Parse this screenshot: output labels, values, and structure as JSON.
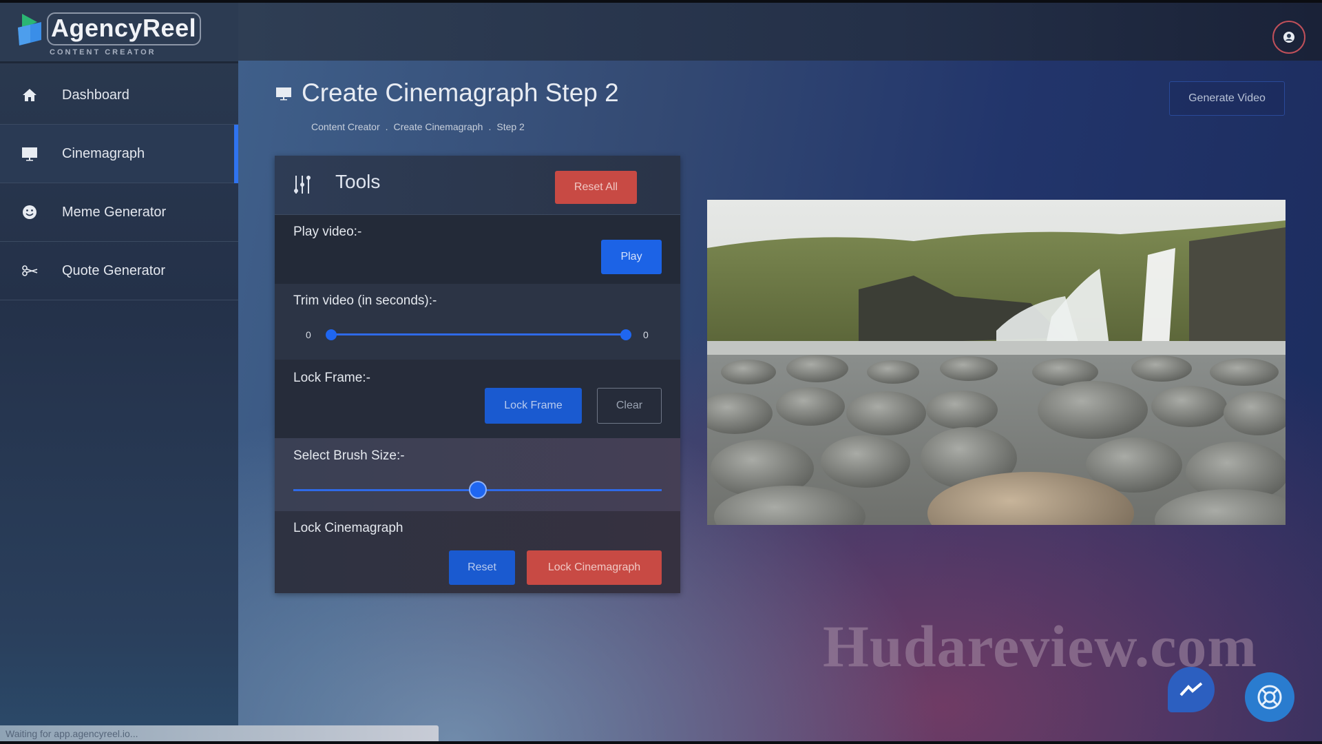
{
  "app": {
    "name": "AgencyReel",
    "tagline": "CONTENT CREATOR",
    "logo_colors": {
      "green": "#2bb673",
      "blue": "#3a8ee8"
    }
  },
  "sidebar": {
    "items": [
      {
        "label": "Dashboard",
        "icon": "home-icon",
        "active": false
      },
      {
        "label": "Cinemagraph",
        "icon": "monitor-icon",
        "active": true
      },
      {
        "label": "Meme Generator",
        "icon": "smiley-icon",
        "active": false
      },
      {
        "label": "Quote Generator",
        "icon": "scissors-icon",
        "active": false
      }
    ]
  },
  "header": {
    "user_icon": "user-avatar-icon"
  },
  "page": {
    "title": "Create Cinemagraph Step 2",
    "title_icon": "monitor-icon",
    "breadcrumb": [
      "Content Creator",
      "Create Cinemagraph",
      "Step 2"
    ],
    "breadcrumb_separator": ".",
    "generate_button": "Generate Video"
  },
  "tools": {
    "title": "Tools",
    "reset_all": "Reset All",
    "play_label": "Play video:-",
    "play_button": "Play",
    "trim_label": "Trim video (in seconds):-",
    "trim_min": "0",
    "trim_max": "0",
    "trim_start_fraction": 0,
    "trim_end_fraction": 1,
    "lock_frame_label": "Lock Frame:-",
    "lock_frame_button": "Lock Frame",
    "clear_button": "Clear",
    "brush_label": "Select Brush Size:-",
    "brush_fraction": 0.5,
    "lock_cinemagraph_label": "Lock Cinemagraph",
    "reset_button": "Reset",
    "lock_cinemagraph_button": "Lock Cinemagraph"
  },
  "preview": {
    "description": "Waterfall over rocky riverbed"
  },
  "watermark": "Hudareview.com",
  "fabs": [
    "messenger-icon",
    "lifebuoy-help-icon"
  ],
  "status_bar": "Waiting for app.agencyreel.io...",
  "colors": {
    "accent_blue": "#1c63e6",
    "danger_red": "#c84a44",
    "active_indicator": "#2f73f0"
  }
}
